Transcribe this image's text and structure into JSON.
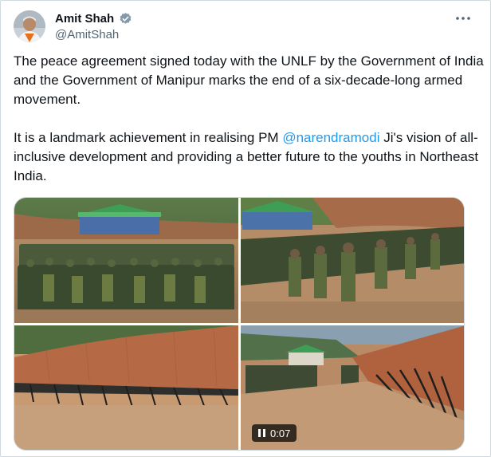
{
  "author": {
    "name": "Amit Shah",
    "handle": "@AmitShah"
  },
  "tweet": {
    "paragraph1": "The peace agreement signed today with the UNLF by the Government of India and the Government of Manipur marks the end of a six-decade-long armed movement.",
    "paragraph2_before": "It is a landmark achievement in realising PM ",
    "mention": "@narendramodi",
    "paragraph2_after": " Ji's vision of all-inclusive development and providing a better future to the youths in Northeast India."
  },
  "media": {
    "video_time": "0:07"
  },
  "colors": {
    "link": "#1d9bf0",
    "verified": "#829aab",
    "secondary_text": "#536471"
  },
  "icons": [
    "verified-badge-icon",
    "more-options-icon",
    "pause-icon"
  ]
}
